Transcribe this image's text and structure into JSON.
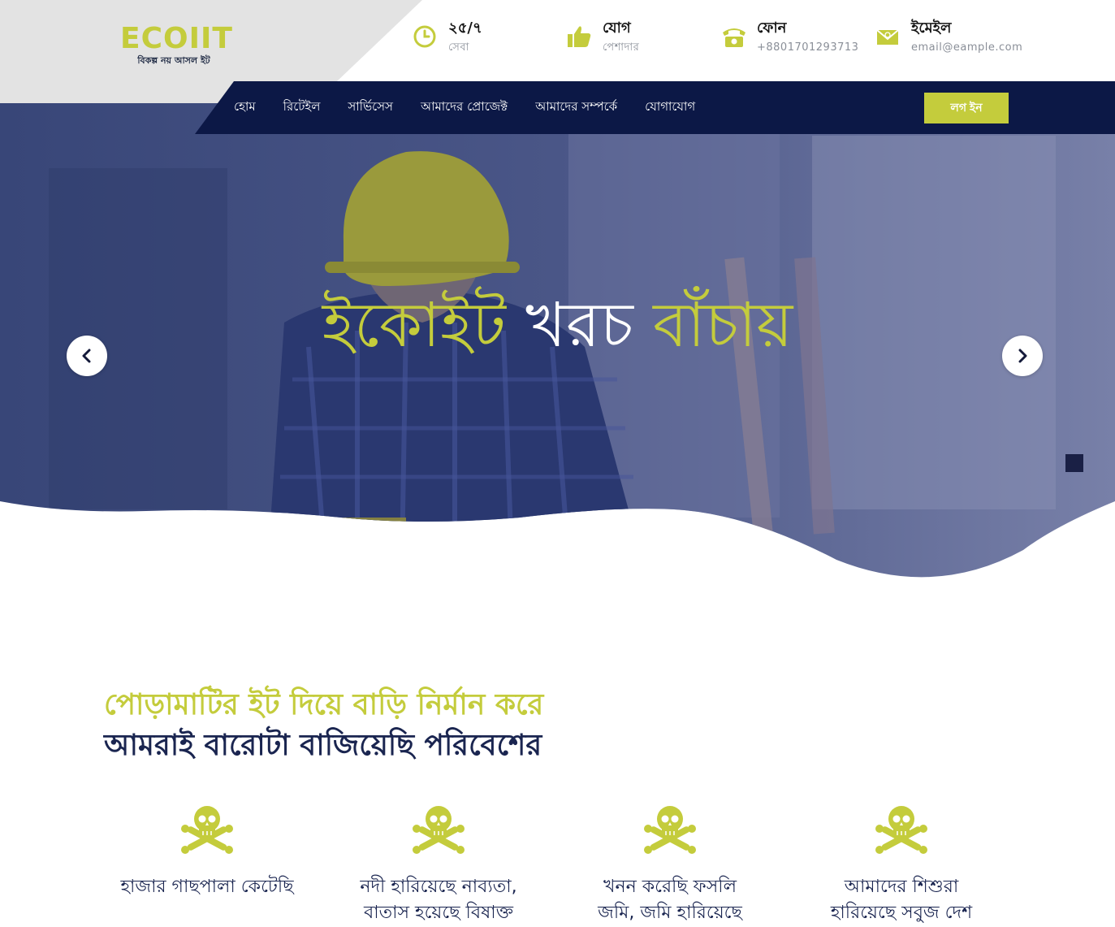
{
  "brand": {
    "name": "ECOIIT",
    "tagline": "বিকল্প নয় আসল ইট"
  },
  "header_info": [
    {
      "icon": "clock-icon",
      "title": "২৫/৭",
      "subtitle": "সেবা"
    },
    {
      "icon": "thumbs-up-icon",
      "title": "যোগ",
      "subtitle": "পেশাদার"
    },
    {
      "icon": "telephone-icon",
      "title": "ফোন",
      "subtitle": "+8801701293713"
    },
    {
      "icon": "envelope-icon",
      "title": "ইমেইল",
      "subtitle": "email@eample.com"
    }
  ],
  "nav": {
    "items": [
      "হোম",
      "রিটেইল",
      "সার্ভিসেস",
      "আমাদের প্রোজেক্ট",
      "আমাদের সম্পর্কে",
      "যোগাযোগ"
    ],
    "login_label": "লগ ইন"
  },
  "hero": {
    "title_part1": "ইকোইট",
    "title_part2": "খরচ",
    "title_part3": "বাঁচায়",
    "prev_icon": "chevron-left-icon",
    "next_icon": "chevron-right-icon"
  },
  "section": {
    "line1": "পোড়ামাটির ইট দিয়ে বাড়ি নির্মান করে",
    "line2": "আমরাই বারোটা বাজিয়েছি পরিবেশের",
    "features": [
      {
        "icon": "skull-crossbones-icon",
        "line1": "হাজার গাছপালা কেটেছি",
        "line2": ""
      },
      {
        "icon": "skull-crossbones-icon",
        "line1": "নদী হারিয়েছে নাব্যতা,",
        "line2": "বাতাস হয়েছে বিষাক্ত"
      },
      {
        "icon": "skull-crossbones-icon",
        "line1": "খনন করেছি ফসলি",
        "line2": "জমি, জমি হারিয়েছে"
      },
      {
        "icon": "skull-crossbones-icon",
        "line1": "আমাদের শিশুরা",
        "line2": "হারিয়েছে সবুজ দেশ"
      }
    ]
  },
  "colors": {
    "accent": "#c4cc3c",
    "navy": "#0c1846",
    "text_dark": "#1a2550",
    "logo_bg": "#e3e3e3"
  }
}
